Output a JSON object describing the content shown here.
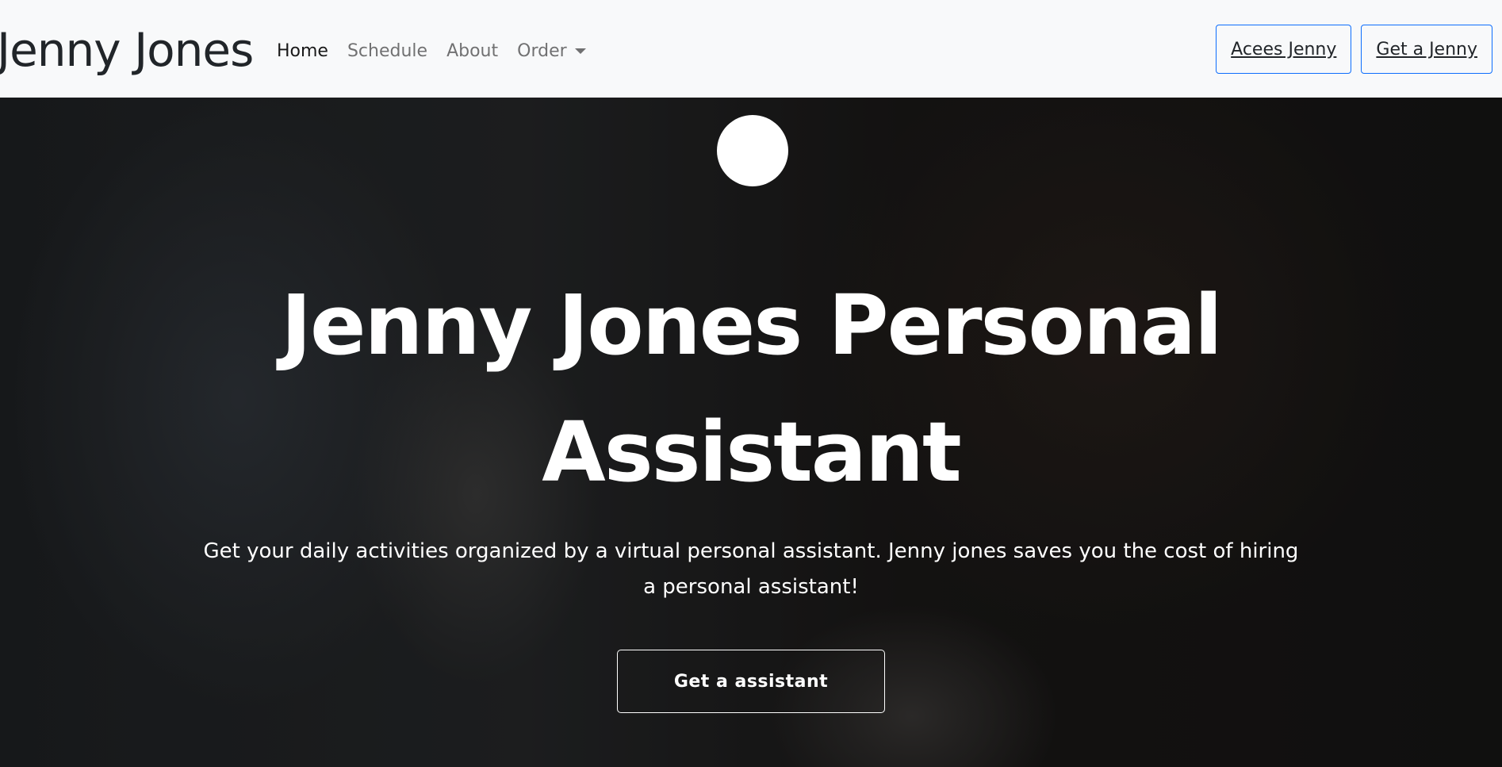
{
  "navbar": {
    "brand": "Jenny Jones",
    "links": [
      {
        "label": "Home"
      },
      {
        "label": "Schedule"
      },
      {
        "label": "About"
      },
      {
        "label": "Order"
      }
    ],
    "actions": [
      {
        "label": "Acees Jenny"
      },
      {
        "label": "Get a Jenny"
      }
    ]
  },
  "hero": {
    "title": "Jenny Jones Personal Assistant",
    "subtitle": "Get your daily activities organized by a virtual personal assistant. Jenny jones saves you the cost of hiring a personal assistant!",
    "cta_label": "Get a assistant"
  },
  "colors": {
    "navbar_bg": "#f8f9fa",
    "button_border": "#0d6efd",
    "hero_text": "#ffffff"
  }
}
